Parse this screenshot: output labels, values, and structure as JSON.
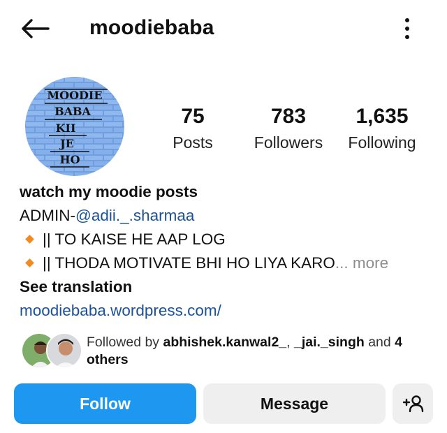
{
  "header": {
    "username": "moodiebaba",
    "back_icon": "arrow-left-icon",
    "more_icon": "more-vertical-icon"
  },
  "avatar": {
    "lines": [
      "MOODIE",
      "BABA",
      "KII",
      "JE",
      "HO"
    ]
  },
  "stats": [
    {
      "value": "75",
      "label": "Posts"
    },
    {
      "value": "783",
      "label": "Followers"
    },
    {
      "value": "1,635",
      "label": "Following"
    }
  ],
  "bio": {
    "name": "watch my moodie posts",
    "admin_prefix": "ADMIN-",
    "admin_handle": "@adii._.sharmaa",
    "line1": "|| TO KAISE HE AAP LOG",
    "line2": "|| THODA MOTIVATE BHI HO LIYA KARO",
    "ellipsis": "...",
    "more": " more",
    "see_translation": "See translation",
    "website": "moodiebaba.wordpress.com/"
  },
  "followed_by": {
    "prefix": "Followed by ",
    "user1": "abhishek.kanwal2_",
    "sep": ", ",
    "user2": "_jai._singh",
    "and_text": " and ",
    "others": "4 others"
  },
  "actions": {
    "follow": "Follow",
    "message": "Message",
    "add_user_icon": "add-person-icon"
  },
  "colors": {
    "follow_bg": "#1d97f0",
    "secondary_btn_bg": "#efefef",
    "link": "#1b5297",
    "bullet": "#f08b23",
    "muted": "#8e8e8e"
  }
}
